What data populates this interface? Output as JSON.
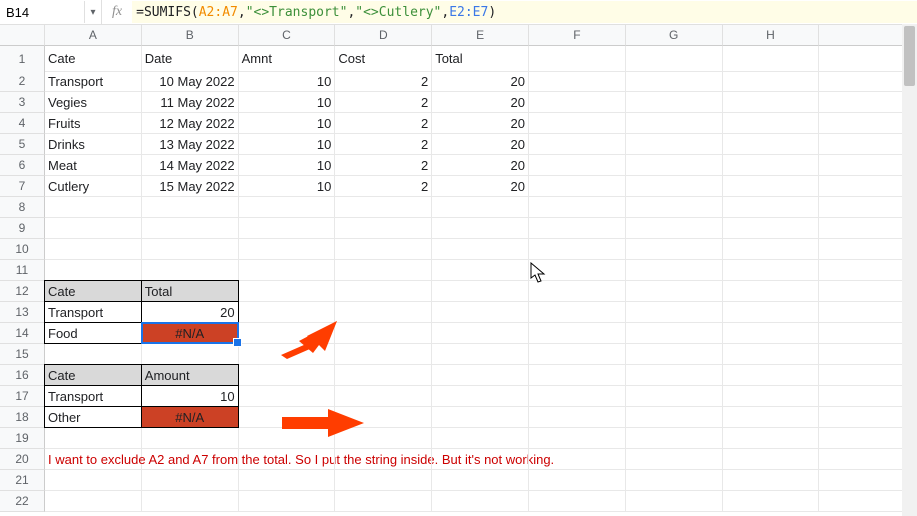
{
  "namebox": "B14",
  "formula_parts": {
    "eq": "=",
    "fn": "SUMIFS(",
    "r1": "A2:A7",
    "c1": ",",
    "s1": "\"<>Transport\"",
    "c2": ",",
    "s2": "\"<>Cutlery\"",
    "c3": ",",
    "r2": "E2:E7",
    "close": ")"
  },
  "cols": [
    "A",
    "B",
    "C",
    "D",
    "E",
    "F",
    "G",
    "H",
    ""
  ],
  "rows_count": 22,
  "headers": {
    "A1": "Cate",
    "B1": "Date",
    "C1": "Amnt",
    "D1": "Cost",
    "E1": "Total"
  },
  "data": [
    {
      "cate": "Transport",
      "date": "10 May 2022",
      "amnt": "10",
      "cost": "2",
      "total": "20"
    },
    {
      "cate": "Vegies",
      "date": "11 May 2022",
      "amnt": "10",
      "cost": "2",
      "total": "20"
    },
    {
      "cate": "Fruits",
      "date": "12 May 2022",
      "amnt": "10",
      "cost": "2",
      "total": "20"
    },
    {
      "cate": "Drinks",
      "date": "13 May 2022",
      "amnt": "10",
      "cost": "2",
      "total": "20"
    },
    {
      "cate": "Meat",
      "date": "14 May 2022",
      "amnt": "10",
      "cost": "2",
      "total": "20"
    },
    {
      "cate": "Cutlery",
      "date": "15 May 2022",
      "amnt": "10",
      "cost": "2",
      "total": "20"
    }
  ],
  "t1": {
    "h1": "Cate",
    "h2": "Total",
    "r1a": "Transport",
    "r1b": "20",
    "r2a": "Food",
    "r2b": "#N/A"
  },
  "t2": {
    "h1": "Cate",
    "h2": "Amount",
    "r1a": "Transport",
    "r1b": "10",
    "r2a": "Other",
    "r2b": "#N/A"
  },
  "note": "I want to exclude A2 and A7 from the total. So I put the string inside. But it's not working.",
  "chart_data": {
    "type": "table",
    "title": "Spreadsheet with SUMIFS formula producing #N/A",
    "main_table": {
      "columns": [
        "Cate",
        "Date",
        "Amnt",
        "Cost",
        "Total"
      ],
      "rows": [
        [
          "Transport",
          "10 May 2022",
          10,
          2,
          20
        ],
        [
          "Vegies",
          "11 May 2022",
          10,
          2,
          20
        ],
        [
          "Fruits",
          "12 May 2022",
          10,
          2,
          20
        ],
        [
          "Drinks",
          "13 May 2022",
          10,
          2,
          20
        ],
        [
          "Meat",
          "14 May 2022",
          10,
          2,
          20
        ],
        [
          "Cutlery",
          "15 May 2022",
          10,
          2,
          20
        ]
      ]
    },
    "summary_tables": [
      {
        "header": [
          "Cate",
          "Total"
        ],
        "rows": [
          [
            "Transport",
            20
          ],
          [
            "Food",
            "#N/A"
          ]
        ]
      },
      {
        "header": [
          "Cate",
          "Amount"
        ],
        "rows": [
          [
            "Transport",
            10
          ],
          [
            "Other",
            "#N/A"
          ]
        ]
      }
    ],
    "formula_in_B14": "=SUMIFS(A2:A7,\"<>Transport\",\"<>Cutlery\",E2:E7)"
  }
}
